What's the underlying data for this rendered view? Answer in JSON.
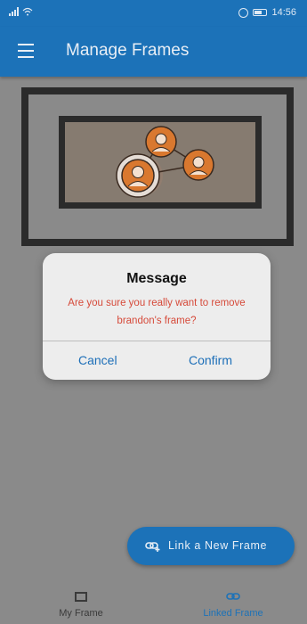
{
  "status_bar": {
    "time": "14:56"
  },
  "app_bar": {
    "title": "Manage Frames",
    "menu_icon": "menu-icon"
  },
  "illustration": {
    "frame_color": "#2b2b2b",
    "person_color": "#d9782f",
    "icons": [
      "person-icon",
      "person-icon",
      "person-icon"
    ]
  },
  "dialog": {
    "title": "Message",
    "message": "Are you sure you really want to remove brandon's frame?",
    "cancel_label": "Cancel",
    "confirm_label": "Confirm",
    "message_color": "#d64a3a",
    "button_color": "#1d6fb8"
  },
  "fab": {
    "label": "Link a New Frame",
    "icon": "link-add-icon"
  },
  "bottom_nav": {
    "items": [
      {
        "label": "My Frame",
        "icon": "frame-icon",
        "active": false
      },
      {
        "label": "Linked Frame",
        "icon": "link-icon",
        "active": true
      }
    ]
  },
  "colors": {
    "primary": "#1c72b8",
    "scrim": "#8a8a8a"
  }
}
